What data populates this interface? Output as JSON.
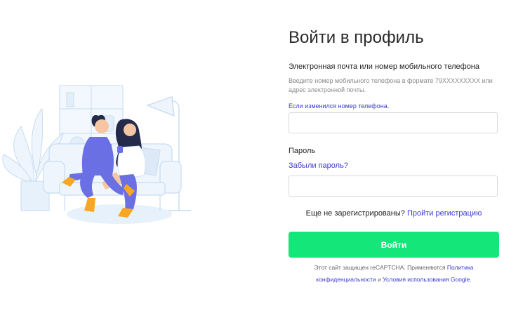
{
  "page": {
    "title": "Войти в профиль"
  },
  "login": {
    "label": "Электронная почта или номер мобильного телефона",
    "hint": "Введите номер мобильного телефона в формате 79XXXXXXXXX или адрес электронной почты.",
    "phone_changed_link": "Если изменился номер телефона.",
    "value": "",
    "placeholder": ""
  },
  "password": {
    "label": "Пароль",
    "forgot_link": "Забыли пароль?",
    "value": "",
    "placeholder": ""
  },
  "register": {
    "question": "Еще не зарегистрированы?",
    "link": "Пройти регистрацию"
  },
  "submit": {
    "label": "Войти"
  },
  "recaptcha": {
    "text_before": "Этот сайт защищен reCAPTCHA. Применяются",
    "privacy_link": "Политика конфиденциальности",
    "and": "и",
    "terms_link": "Условия использования Google",
    "end": "."
  },
  "colors": {
    "accent_green": "#14e67a",
    "link_blue": "#3a3ad1",
    "couple_purple": "#6a6fe4",
    "couple_orange": "#f7a823"
  },
  "illustration": {
    "name": "couple-on-sofa-illustration"
  }
}
